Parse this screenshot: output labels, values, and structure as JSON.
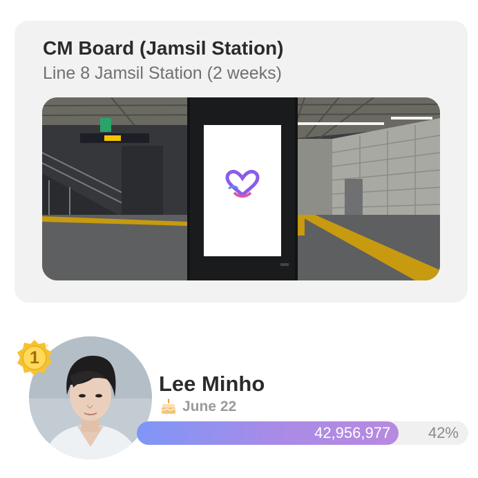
{
  "ad_card": {
    "title": "CM Board (Jamsil Station)",
    "subtitle": "Line 8 Jamsil Station (2 weeks)",
    "photo_icon": "subway-station-photo",
    "screen_logo_icon": "heart-logo-icon"
  },
  "ranking": {
    "rank": "1",
    "medal_icon": "gold-medal-icon",
    "avatar_icon": "artist-photo",
    "name": "Lee Minho",
    "birthday_icon": "cake-icon",
    "birthday": "June 22",
    "votes": "42,956,977",
    "percent_label": "42%",
    "progress_fraction": 0.79
  },
  "colors": {
    "accent_start": "#7f96f7",
    "accent_end": "#b78ae0",
    "medal_gold": "#f5c233",
    "card_bg": "#f2f2f2"
  }
}
